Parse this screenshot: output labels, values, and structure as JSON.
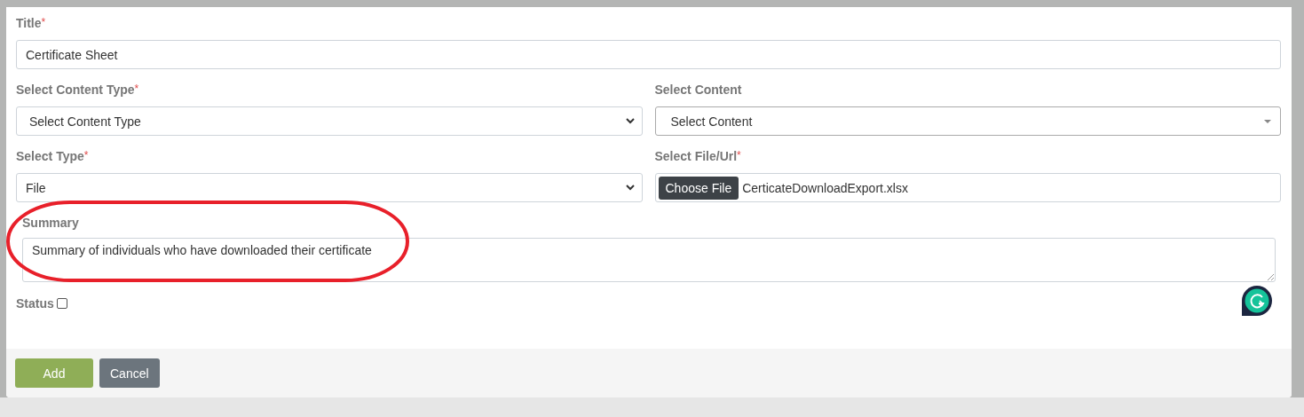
{
  "title_field": {
    "label": "Title",
    "required_mark": "*",
    "value": "Certificate Sheet"
  },
  "content_type": {
    "label": "Select Content Type",
    "required_mark": "*",
    "value": "Select Content Type"
  },
  "content": {
    "label": "Select Content",
    "value": "Select Content"
  },
  "type": {
    "label": "Select Type",
    "required_mark": "*",
    "value": "File"
  },
  "file": {
    "label": "Select File/Url",
    "required_mark": "*",
    "button": "Choose File",
    "filename": "CerticateDownloadExport.xlsx"
  },
  "summary": {
    "label": "Summary",
    "value": "Summary of individuals who have downloaded their certificate"
  },
  "status": {
    "label": "Status",
    "checked": false
  },
  "buttons": [
    {
      "label": "Add",
      "kind": "primary"
    },
    {
      "label": "Cancel",
      "kind": "secondary"
    }
  ]
}
